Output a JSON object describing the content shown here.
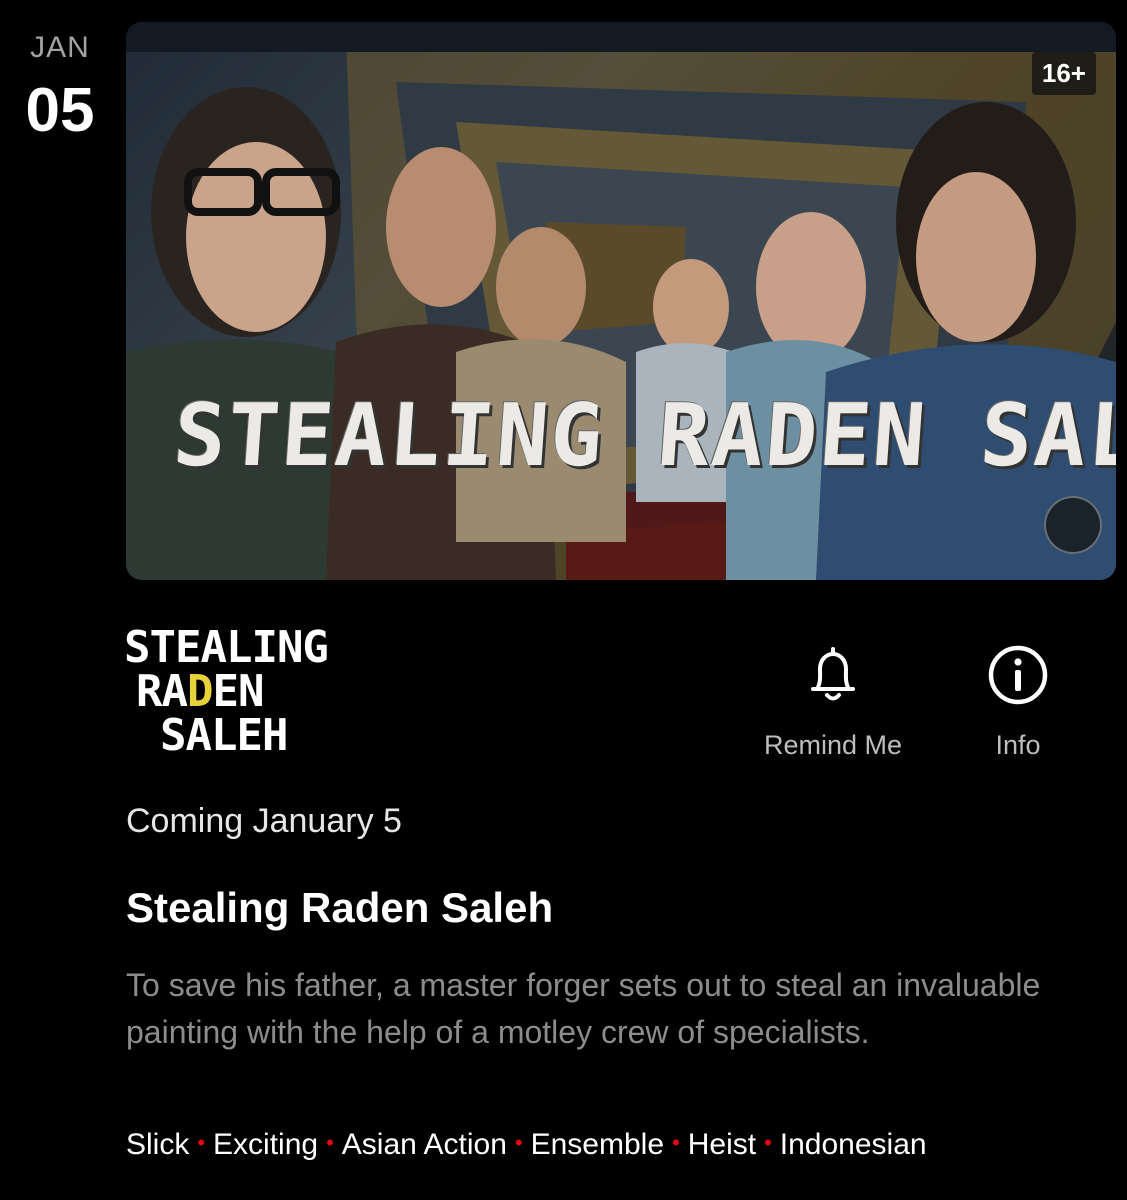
{
  "date": {
    "month": "JAN",
    "day": "05"
  },
  "hero": {
    "title_art": "STEALING RADEN SALEH",
    "rating": "16+",
    "mute_icon": "speaker-muted-icon"
  },
  "logo": {
    "line1": "STEALING",
    "line2_a": "RA",
    "line2_b": "D",
    "line2_c": "EN",
    "line3": "SALEH"
  },
  "actions": {
    "remind": {
      "label": "Remind Me",
      "icon": "bell-icon"
    },
    "info": {
      "label": "Info",
      "icon": "info-icon"
    }
  },
  "release_text": "Coming January 5",
  "title": "Stealing Raden Saleh",
  "synopsis": "To save his father, a master forger sets out to steal an invaluable painting with the help of a motley crew of specialists.",
  "tags": [
    "Slick",
    "Exciting",
    "Asian Action",
    "Ensemble",
    "Heist",
    "Indonesian"
  ],
  "colors": {
    "background": "#000000",
    "tag_separator": "#e50914",
    "logo_accent": "#e8d23a"
  }
}
